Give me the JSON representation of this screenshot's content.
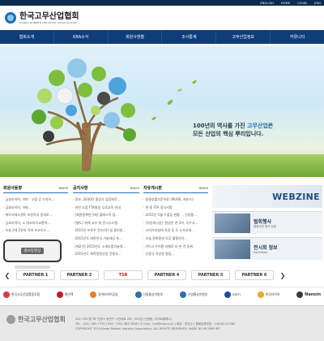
{
  "utility": [
    "ENGLISH",
    "HOME",
    "LOGIN",
    "JOIN"
  ],
  "logo": {
    "korean": "한국고무산업협회",
    "english": "KOREA RUBBER INDUSTRY ASSOCIATION"
  },
  "nav": [
    "협회소개",
    "KRA소식",
    "회원사현황",
    "조사통계",
    "고무산업정보",
    "커뮤니티"
  ],
  "hero": {
    "line1_prefix": "100년의 역사를 가진 ",
    "line1_highlight": "고무산업",
    "line1_suffix": "은",
    "line2": "모든 산업의 핵심 뿌리입니다."
  },
  "panels": {
    "members": {
      "title": "회원사동향",
      "more": "more",
      "items": [
        "· 금호타이어, 이파 · 고점 공 드라이...",
        "· 금호타이어, 어파...",
        "· 에르서에스센트 프랑이자 동처로...",
        "· 금호타이어, 소 대코하이교환약...",
        "· 녹슬 2대 2유의 이마 프조이스..."
      ]
    },
    "notice": {
      "title": "공지사항",
      "more": "more",
      "items": [
        "· 정보, 2030년 중장기 검증회로...",
        "· 하반 오점 FTA원동 무료교육 안내",
        "· [회원정책연구회] 플레스틱 참..",
        "· [별도] 위해 교유 위 전시시스템",
        "· 2015년 프로우 컨조(치) 일 용비방...",
        "· 2015년도 대한민국 기술대상 포...",
        "· [제2기] 2015년도 소재부품기술개...",
        "· 2015년도 화학원정산업 진흥유..."
      ]
    },
    "market": {
      "title": "자유게시판",
      "more": "more",
      "items": [
        "· 용용호를가운이료 (MURE, 캐조드)",
        "· 한·중 FTA 정식서명",
        "· 2015년 5월 수출입 현황 ... 산업통...",
        "· [부동화시장] '원양안 연 2억, 무우사...",
        "· 고려가라설대 직권 징 도 소가요개...",
        "· 오늘 원위원영 모공 활용하이...",
        "· (주)고 우이환 자폐로 타 본 컨 동위",
        "· 신중규 이성한 평업..."
      ]
    }
  },
  "video": {
    "label": "홍보동영상"
  },
  "webzine": {
    "label": "WEBZINE"
  },
  "side_cards": [
    {
      "title": "협회행사",
      "sub": "협회관련 행사 일정"
    },
    {
      "title": "전시회 정보",
      "sub": "Exhibition"
    }
  ],
  "partners": [
    "PARTNER 1",
    "PARTNER 2",
    "TSR",
    "PARTNER 4",
    "PARTNER 5",
    "PARTNER 6"
  ],
  "assocs": [
    {
      "name": "한국고무산업협동조합",
      "color": "#d73a3a"
    },
    {
      "name": "화인텍",
      "color": "#c02020"
    },
    {
      "name": "동아타이어공업",
      "color": "#e4822c"
    },
    {
      "name": "산업통상자원부",
      "color": "#2f6db4"
    },
    {
      "name": "산업통상자원부",
      "color": "#2f6db4"
    },
    {
      "name": "KRITI",
      "color": "#1d4f9b"
    },
    {
      "name": "한국타이어",
      "color": "#e8a92c"
    },
    {
      "name": "Nanoin",
      "color": "#3a3a3a"
    }
  ],
  "footer": {
    "logo": "한국고무산업협회",
    "line1": "431-700 경기도 안양시 동안구 시민대로 287, 503호 (관양동, 아크로텔레스)",
    "line2": "TEL : 031) 383-7750  |  FAX : 031) 383-7840  |  E-mail : kra@krsa.or.kr  |  회장 : 류관수  |  협회등록번호 : 138-82-07380",
    "line3": "COPYRIGHT 2014 Korea Rubber Industry Association, ALL RIGHTS RESERVED. MADE BY HICOMP INT"
  }
}
